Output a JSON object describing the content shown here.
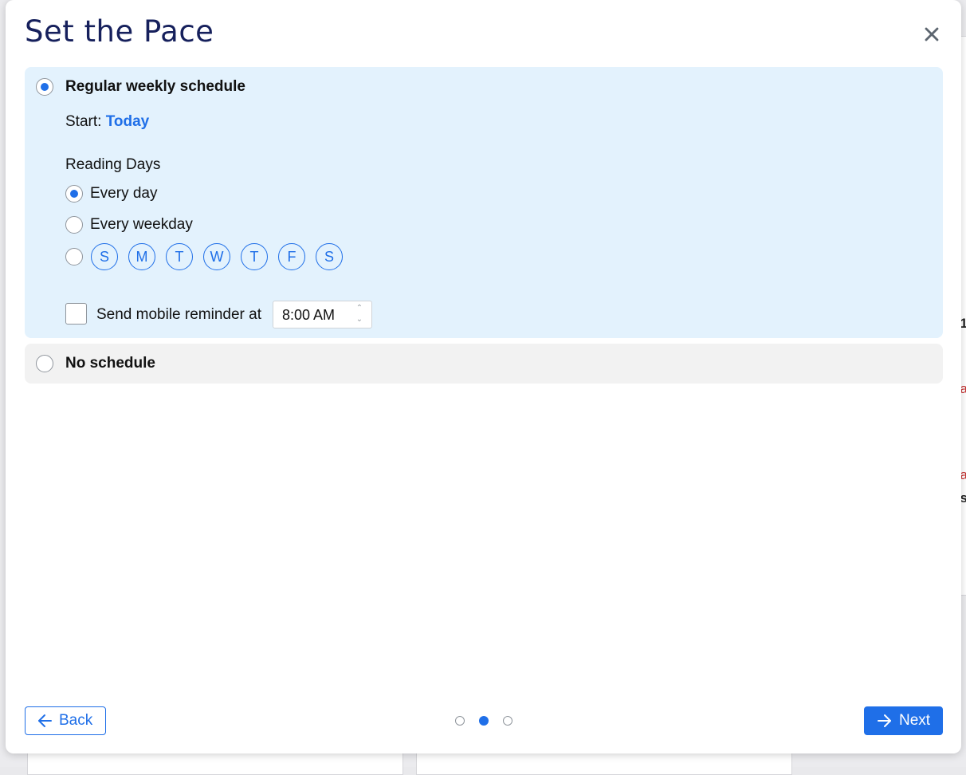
{
  "modal": {
    "title": "Set the Pace"
  },
  "schedule": {
    "regular": {
      "label": "Regular weekly schedule",
      "selected": true,
      "start_label": "Start:",
      "start_value": "Today",
      "reading_days_label": "Reading Days",
      "options": [
        {
          "label": "Every day",
          "selected": true
        },
        {
          "label": "Every weekday",
          "selected": false
        },
        {
          "label": "",
          "selected": false
        }
      ],
      "days": [
        "S",
        "M",
        "T",
        "W",
        "T",
        "F",
        "S"
      ],
      "reminder": {
        "label": "Send mobile reminder at",
        "checked": false,
        "time": "8:00 AM"
      }
    },
    "none": {
      "label": "No schedule",
      "selected": false
    }
  },
  "footer": {
    "back_label": "Back",
    "next_label": "Next",
    "pager": {
      "total": 3,
      "current": 2
    }
  },
  "background": {
    "fragments": [
      "1",
      "a",
      "a",
      "s"
    ]
  },
  "colors": {
    "accent": "#1f6fe8",
    "title": "#16205c",
    "panel_selected": "#e3f2fd",
    "panel_unselected": "#f2f2f2"
  }
}
